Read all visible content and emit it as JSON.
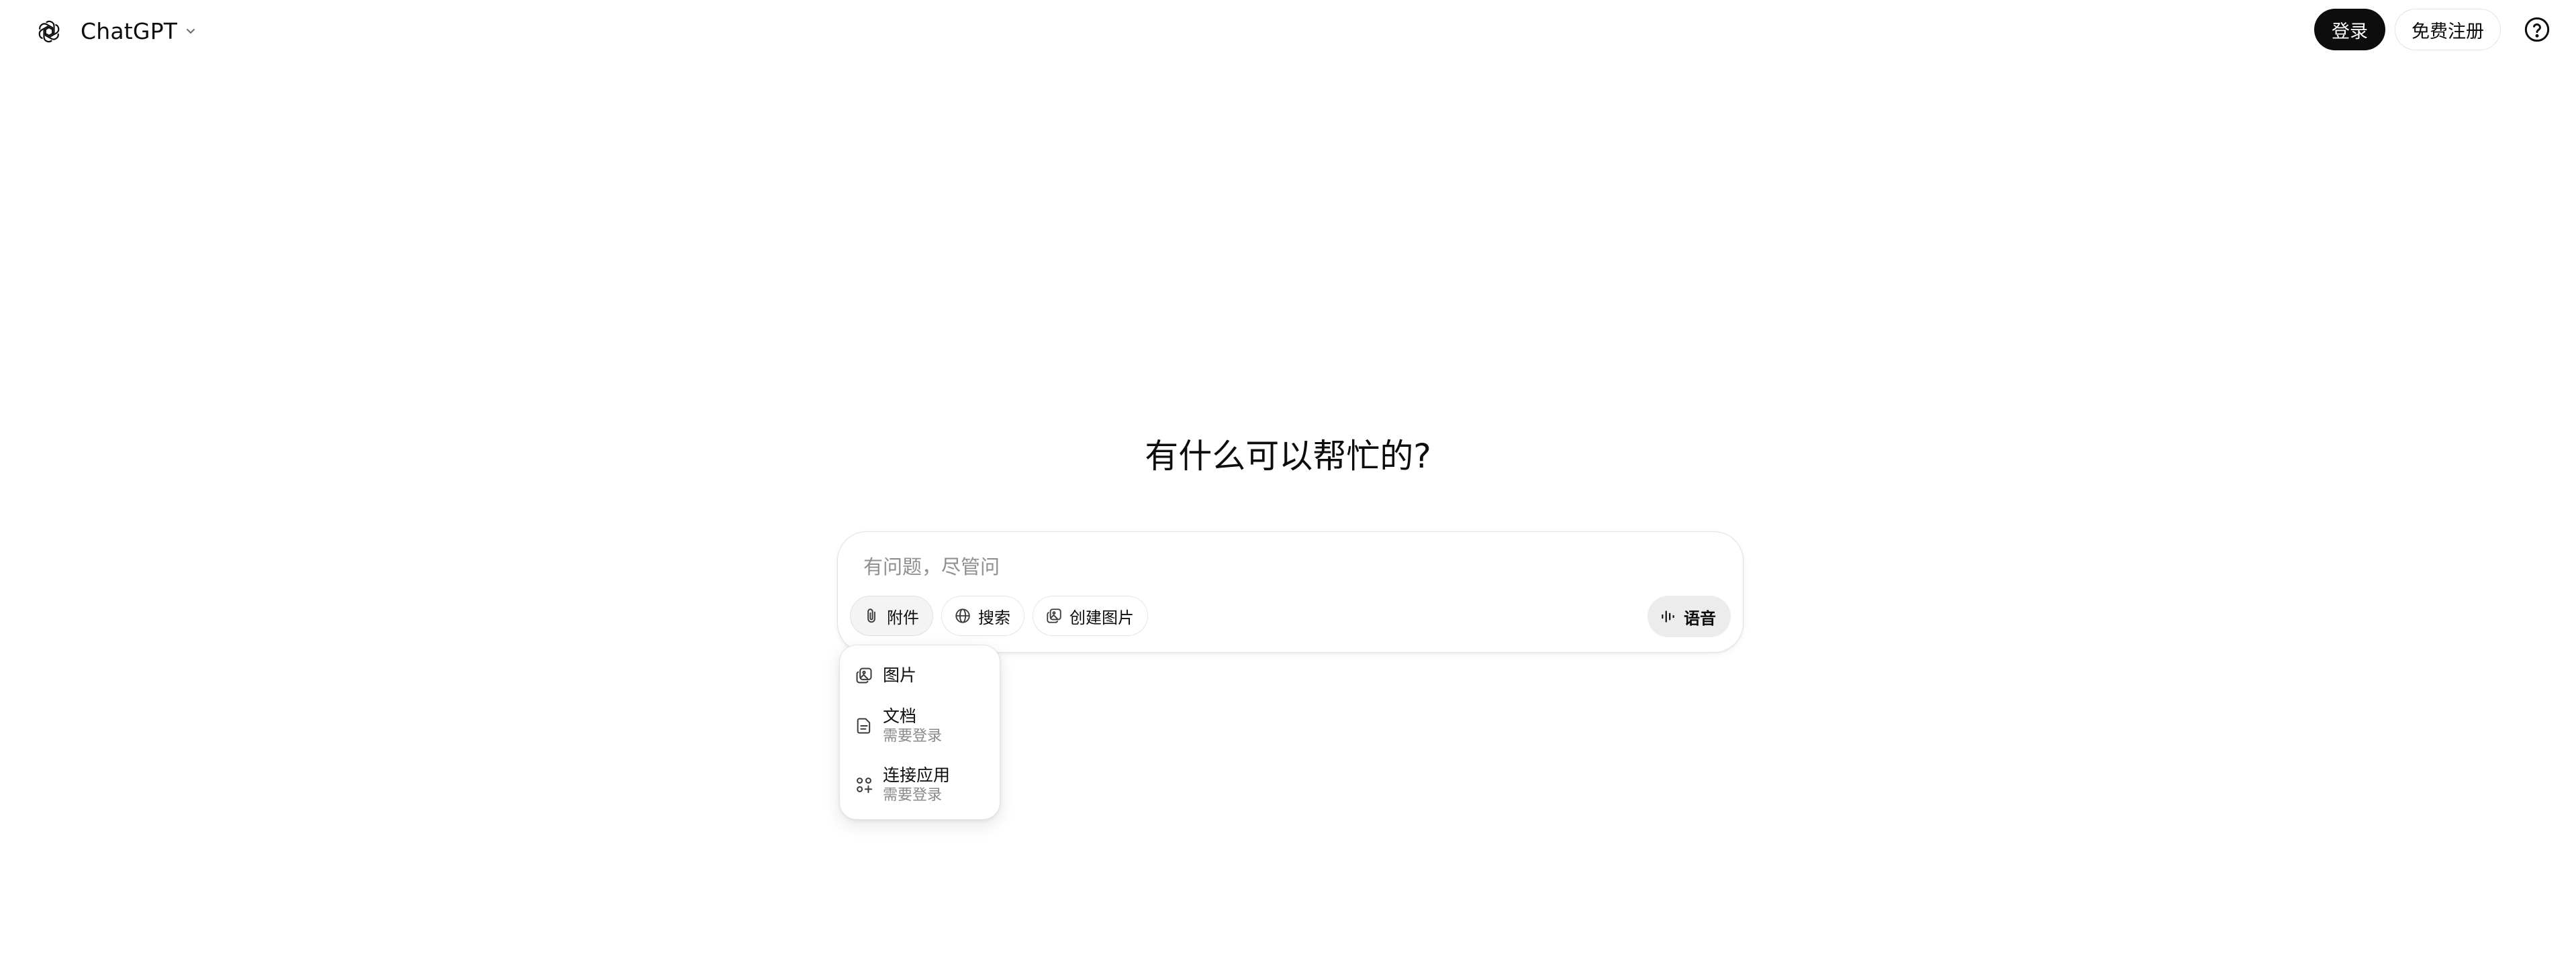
{
  "header": {
    "logo_icon": "openai-logo-icon",
    "model_name": "ChatGPT",
    "login_label": "登录",
    "signup_label": "免费注册",
    "help_icon": "help-circle-icon"
  },
  "main": {
    "headline": "有什么可以帮忙的?",
    "composer": {
      "placeholder": "有问题，尽管问",
      "value": "",
      "tools": [
        {
          "label": "附件",
          "icon": "paperclip-icon"
        },
        {
          "label": "搜索",
          "icon": "globe-icon"
        },
        {
          "label": "创建图片",
          "icon": "image-create-icon"
        }
      ],
      "voice_label": "语音",
      "voice_icon": "voice-wave-icon"
    },
    "attach_menu": {
      "items": [
        {
          "label": "图片",
          "sub": "",
          "icon": "image-icon"
        },
        {
          "label": "文档",
          "sub": "需要登录",
          "icon": "document-icon"
        },
        {
          "label": "连接应用",
          "sub": "需要登录",
          "icon": "apps-grid-icon"
        }
      ]
    }
  },
  "colors": {
    "primary_text": "#0d0d0d",
    "muted_text": "#8f8f8f",
    "login_bg": "#0d0d0d",
    "voice_bg": "#ececec"
  }
}
